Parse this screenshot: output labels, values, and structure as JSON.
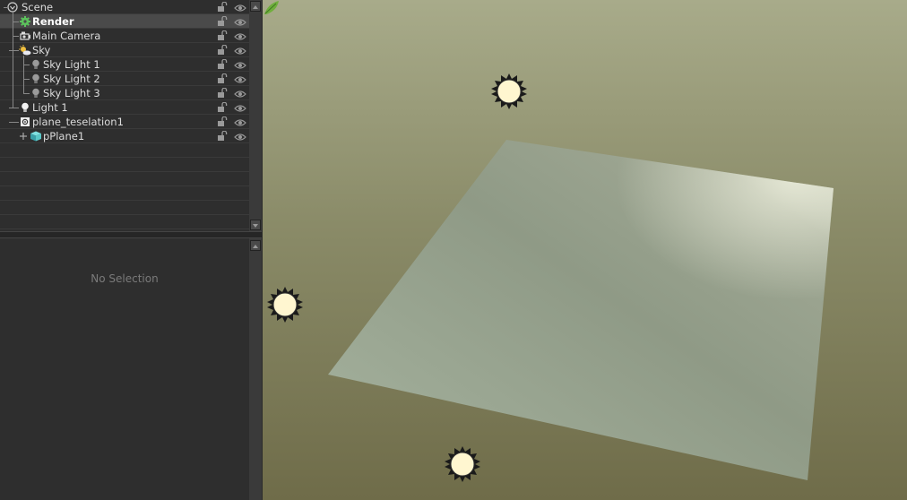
{
  "outliner": {
    "items": [
      {
        "label": "Scene",
        "icon": "scene-icon",
        "depth": 0
      },
      {
        "label": "Render",
        "icon": "render-gear-icon",
        "depth": 1,
        "selected": true
      },
      {
        "label": "Main Camera",
        "icon": "camera-icon",
        "depth": 1
      },
      {
        "label": "Sky",
        "icon": "sky-icon",
        "depth": 1
      },
      {
        "label": "Sky Light 1",
        "icon": "light-bulb-icon",
        "depth": 2
      },
      {
        "label": "Sky Light 2",
        "icon": "light-bulb-icon",
        "depth": 2
      },
      {
        "label": "Sky Light 3",
        "icon": "light-bulb-icon",
        "depth": 2
      },
      {
        "label": "Light 1",
        "icon": "light-bulb-icon",
        "depth": 1
      },
      {
        "label": "plane_teselation1",
        "icon": "tessellation-icon",
        "depth": 1
      },
      {
        "label": "pPlane1",
        "icon": "mesh-cube-icon",
        "depth": 2
      }
    ]
  },
  "properties": {
    "empty_text": "No Selection"
  },
  "colors": {
    "panel_bg": "#2e2e2e",
    "selected_row": "#4a4a4a",
    "viewport_top": "#a8ab8a",
    "viewport_bottom": "#6f6c49",
    "plane": "#9aa590",
    "light_fill": "#fff6d0"
  }
}
